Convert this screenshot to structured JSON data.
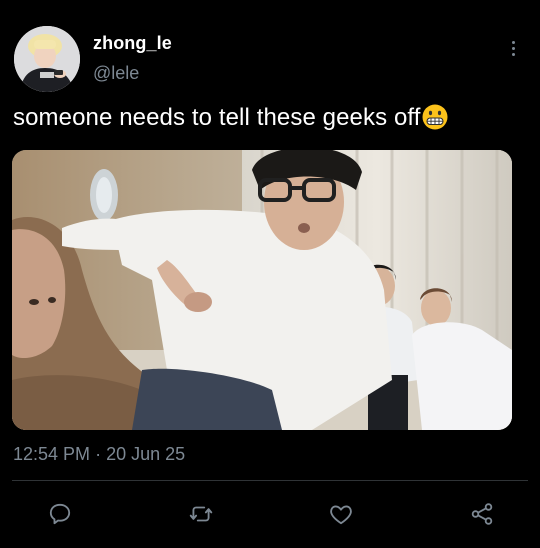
{
  "author": {
    "display_name": "zhong_le",
    "handle": "@lele"
  },
  "tweet": {
    "text": "someone needs to tell these geeks off",
    "emoji": "grimacing-face-emoji"
  },
  "meta": {
    "time": "12:54 PM",
    "separator": "·",
    "date": "20 Jun 25"
  },
  "actions": [
    "reply-icon",
    "retweet-icon",
    "like-icon",
    "share-icon"
  ],
  "colors": {
    "background": "#000000",
    "primary_text": "#ffffff",
    "secondary_text": "#7d8893",
    "divider": "#2f3336"
  }
}
